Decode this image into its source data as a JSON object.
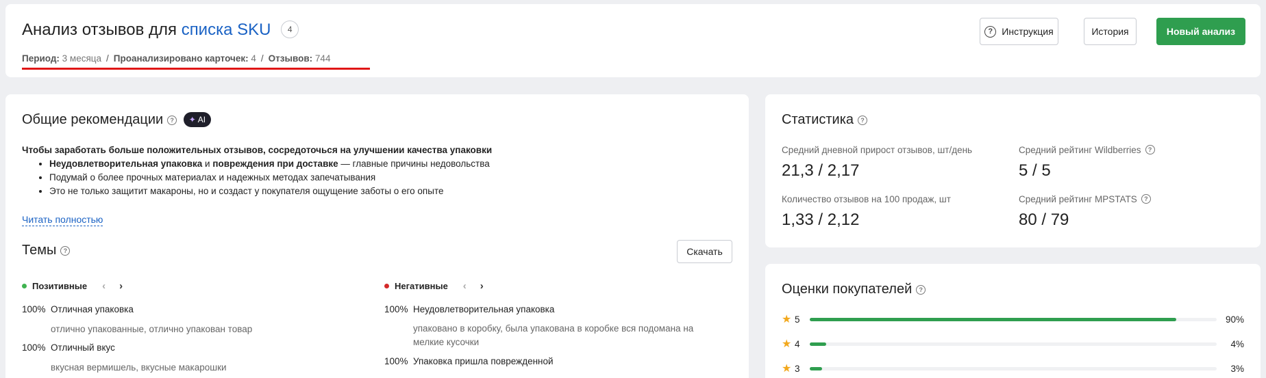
{
  "header": {
    "title_prefix": "Анализ отзывов для",
    "title_link": "списка SKU",
    "count_badge": "4",
    "period_label": "Период:",
    "period_value": "3 месяца",
    "cards_label": "Проанализировано карточек:",
    "cards_value": "4",
    "reviews_label": "Отзывов:",
    "reviews_value": "744",
    "separator": "/",
    "buttons": {
      "instruction": "Инструкция",
      "history": "История",
      "new_analysis": "Новый анализ"
    }
  },
  "recommendations": {
    "title": "Общие рекомендации",
    "ai_badge": "AI",
    "lead": "Чтобы заработать больше положительных отзывов, сосредоточься на улучшении качества упаковки",
    "bullet1_bold_a": "Неудовлетворительная упаковка",
    "bullet1_and": " и ",
    "bullet1_bold_b": "повреждения при доставке",
    "bullet1_rest": " — главные причины недовольства",
    "bullet2": "Подумай о более прочных материалах и надежных методах запечатывания",
    "bullet3": "Это не только защитит макароны, но и создаст у покупателя ощущение заботы о его опыте",
    "read_more": "Читать полностью"
  },
  "topics": {
    "title": "Темы",
    "download": "Скачать",
    "positive": {
      "label": "Позитивные",
      "color": "#3fb350",
      "items": [
        {
          "pct": "100%",
          "name": "Отличная упаковка",
          "details": "отлично упакованные, отлично упакован товар"
        },
        {
          "pct": "100%",
          "name": "Отличный вкус",
          "details": "вкусная вермишель, вкусные макарошки"
        }
      ]
    },
    "negative": {
      "label": "Негативные",
      "color": "#d42a2a",
      "items": [
        {
          "pct": "100%",
          "name": "Неудовлетворительная упаковка",
          "details": "упаковано в коробку, была упакована в коробке вся подомана на мелкие кусочки"
        },
        {
          "pct": "100%",
          "name": "Упаковка пришла поврежденной",
          "details": ""
        }
      ]
    }
  },
  "stats": {
    "title": "Статистика",
    "daily_growth_label": "Средний дневной прирост отзывов, шт/день",
    "daily_growth_value": "21,3 / 2,17",
    "wb_rating_label": "Средний рейтинг Wildberries",
    "wb_rating_value": "5 / 5",
    "per100_label": "Количество отзывов на 100 продаж, шт",
    "per100_value": "1,33 / 2,12",
    "mpstats_label": "Средний рейтинг MPSTATS",
    "mpstats_value": "80 / 79"
  },
  "ratings": {
    "title": "Оценки покупателей",
    "bar_color": "#2f9e4f",
    "rows": [
      {
        "stars": "5",
        "percent": "90%",
        "fraction": 0.9
      },
      {
        "stars": "4",
        "percent": "4%",
        "fraction": 0.04
      },
      {
        "stars": "3",
        "percent": "3%",
        "fraction": 0.03
      }
    ]
  }
}
